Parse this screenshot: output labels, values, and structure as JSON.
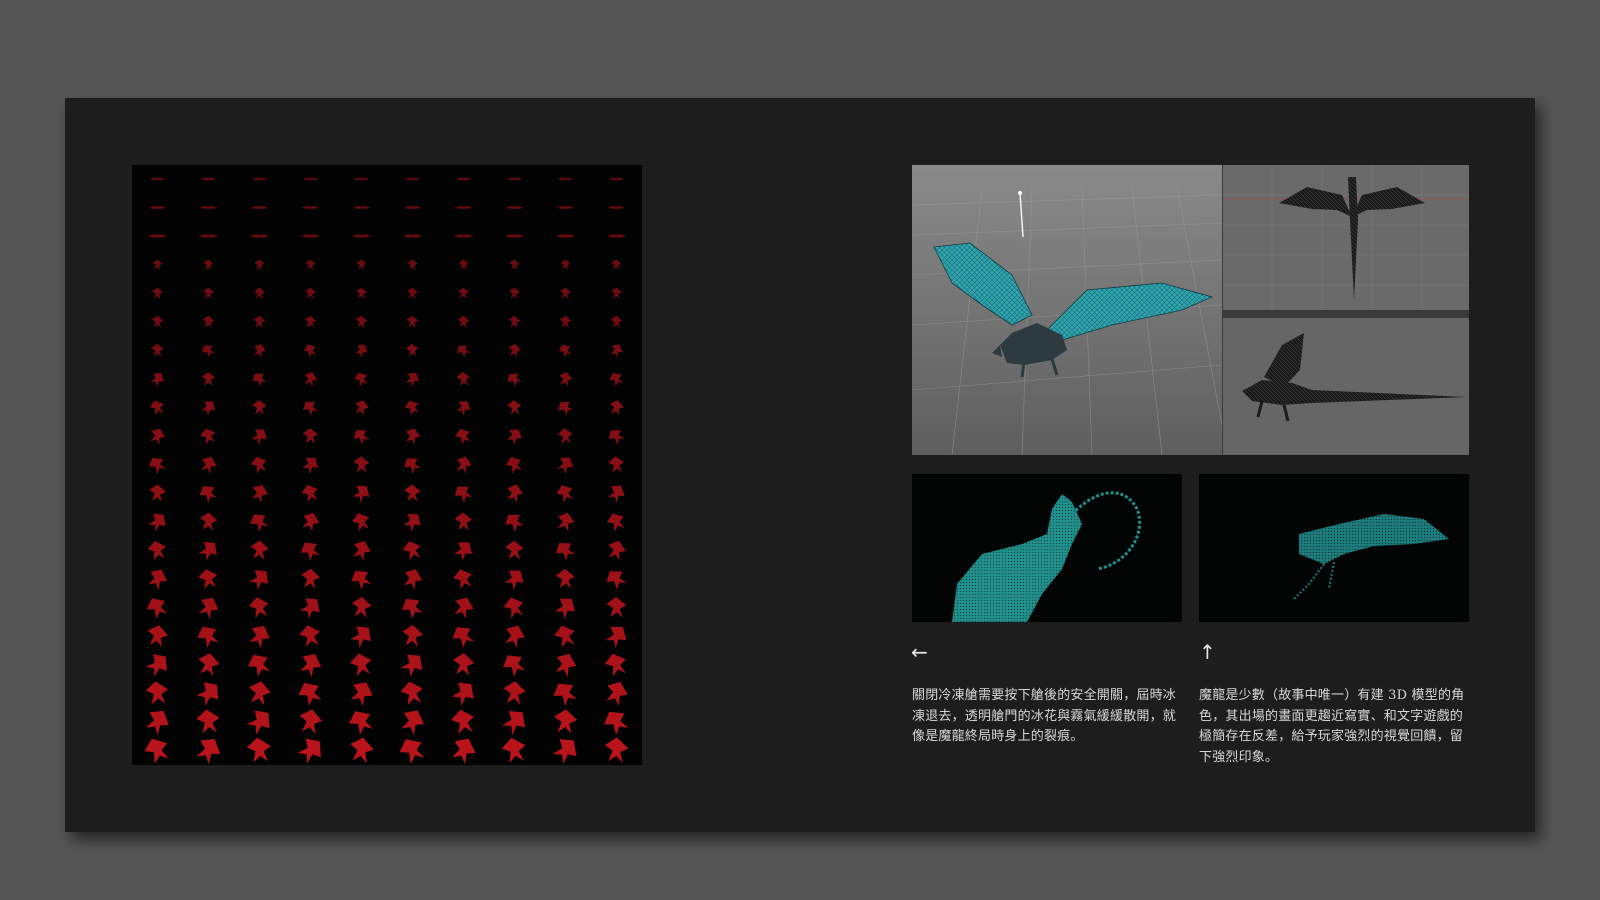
{
  "panels": {
    "spritesheet": {
      "color": "#c3141c",
      "rows": 21,
      "cols": 10
    },
    "viewport": {
      "left_color": "#6f6f6f",
      "mesh_color": "#2fa6b0",
      "right_color": "#6a6a6a"
    },
    "render_left": {
      "color": "#1f8f8c"
    },
    "render_right": {
      "color": "#1b7c7e"
    }
  },
  "arrows": {
    "left": "←",
    "up": "↑"
  },
  "captions": {
    "left": "關閉冷凍艙需要按下艙後的安全開關，屆時冰凍退去，透明艙門的冰花與霧氣緩緩散開，就像是魔龍終局時身上的裂痕。",
    "right": "魔龍是少數（故事中唯一）有建 3D 模型的角色，其出場的畫面更趨近寫實、和文字遊戲的極簡存在反差，給予玩家強烈的視覺回饋，留下強烈印象。"
  }
}
